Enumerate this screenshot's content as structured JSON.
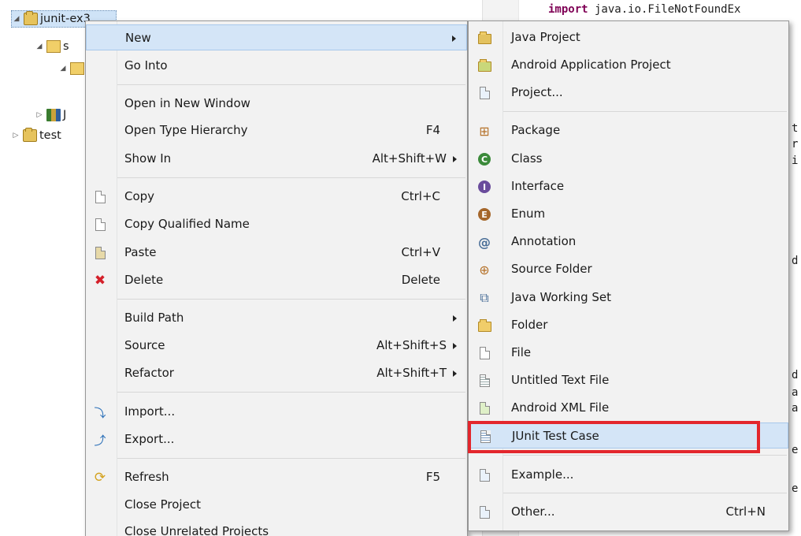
{
  "explorer": {
    "items": [
      {
        "label": "junit-ex3",
        "icon": "java-project-icon",
        "state": "expanded",
        "selected": true
      },
      {
        "label": "s",
        "icon": "source-folder-icon",
        "state": "expanded"
      },
      {
        "label": "",
        "icon": "package-icon",
        "state": "expanded"
      },
      {
        "label": "J",
        "icon": "library-icon",
        "state": "collapsed"
      },
      {
        "label": "test",
        "icon": "java-project-icon",
        "state": "collapsed"
      }
    ]
  },
  "editor": {
    "visible_code": {
      "keyword": "import",
      "line1_rest": " java.io.FileNotFoundEx",
      "fragments": [
        "t",
        "r",
        "i",
        "d",
        "d",
        "a",
        "a",
        "e",
        "e"
      ]
    }
  },
  "context_menu": {
    "items": [
      {
        "label": "New",
        "accel": "",
        "submenu": true,
        "icon": "",
        "highlighted": true
      },
      {
        "label": "Go Into",
        "accel": "",
        "submenu": false,
        "icon": ""
      },
      {
        "label": "Open in New Window",
        "accel": "",
        "submenu": false,
        "icon": ""
      },
      {
        "label": "Open Type Hierarchy",
        "accel": "F4",
        "submenu": false,
        "icon": ""
      },
      {
        "label": "Show In",
        "accel": "Alt+Shift+W",
        "submenu": true,
        "icon": ""
      },
      {
        "label": "Copy",
        "accel": "Ctrl+C",
        "submenu": false,
        "icon": "copy-icon"
      },
      {
        "label": "Copy Qualified Name",
        "accel": "",
        "submenu": false,
        "icon": "copy-qualified-name-icon"
      },
      {
        "label": "Paste",
        "accel": "Ctrl+V",
        "submenu": false,
        "icon": "paste-icon"
      },
      {
        "label": "Delete",
        "accel": "Delete",
        "submenu": false,
        "icon": "delete-icon"
      },
      {
        "label": "Build Path",
        "accel": "",
        "submenu": true,
        "icon": ""
      },
      {
        "label": "Source",
        "accel": "Alt+Shift+S",
        "submenu": true,
        "icon": ""
      },
      {
        "label": "Refactor",
        "accel": "Alt+Shift+T",
        "submenu": true,
        "icon": ""
      },
      {
        "label": "Import...",
        "accel": "",
        "submenu": false,
        "icon": "import-icon"
      },
      {
        "label": "Export...",
        "accel": "",
        "submenu": false,
        "icon": "export-icon"
      },
      {
        "label": "Refresh",
        "accel": "F5",
        "submenu": false,
        "icon": "refresh-icon"
      },
      {
        "label": "Close Project",
        "accel": "",
        "submenu": false,
        "icon": ""
      },
      {
        "label": "Close Unrelated Projects",
        "accel": "",
        "submenu": false,
        "icon": ""
      }
    ]
  },
  "new_submenu": {
    "items": [
      {
        "label": "Java Project",
        "accel": "",
        "icon": "java-project-icon"
      },
      {
        "label": "Android Application Project",
        "accel": "",
        "icon": "android-project-icon"
      },
      {
        "label": "Project...",
        "accel": "",
        "icon": "project-icon"
      },
      {
        "label": "Package",
        "accel": "",
        "icon": "package-icon"
      },
      {
        "label": "Class",
        "accel": "",
        "icon": "class-icon",
        "glyph": "C"
      },
      {
        "label": "Interface",
        "accel": "",
        "icon": "interface-icon",
        "glyph": "I"
      },
      {
        "label": "Enum",
        "accel": "",
        "icon": "enum-icon",
        "glyph": "E"
      },
      {
        "label": "Annotation",
        "accel": "",
        "icon": "annotation-icon",
        "glyph": "@"
      },
      {
        "label": "Source Folder",
        "accel": "",
        "icon": "source-folder-icon"
      },
      {
        "label": "Java Working Set",
        "accel": "",
        "icon": "working-set-icon"
      },
      {
        "label": "Folder",
        "accel": "",
        "icon": "folder-icon"
      },
      {
        "label": "File",
        "accel": "",
        "icon": "file-icon"
      },
      {
        "label": "Untitled Text File",
        "accel": "",
        "icon": "text-file-icon"
      },
      {
        "label": "Android XML File",
        "accel": "",
        "icon": "android-xml-icon"
      },
      {
        "label": "JUnit Test Case",
        "accel": "",
        "icon": "junit-test-case-icon",
        "highlighted": true
      },
      {
        "label": "Example...",
        "accel": "",
        "icon": "example-icon"
      },
      {
        "label": "Other...",
        "accel": "Ctrl+N",
        "icon": "other-icon"
      }
    ]
  },
  "colors": {
    "menu_bg": "#f2f2f2",
    "hover_bg": "#d4e5f7",
    "annotation_box": "#e3262c",
    "class_icon": "#3b8a3a",
    "interface_icon": "#6a4c9c",
    "enum_icon": "#a5662a"
  }
}
